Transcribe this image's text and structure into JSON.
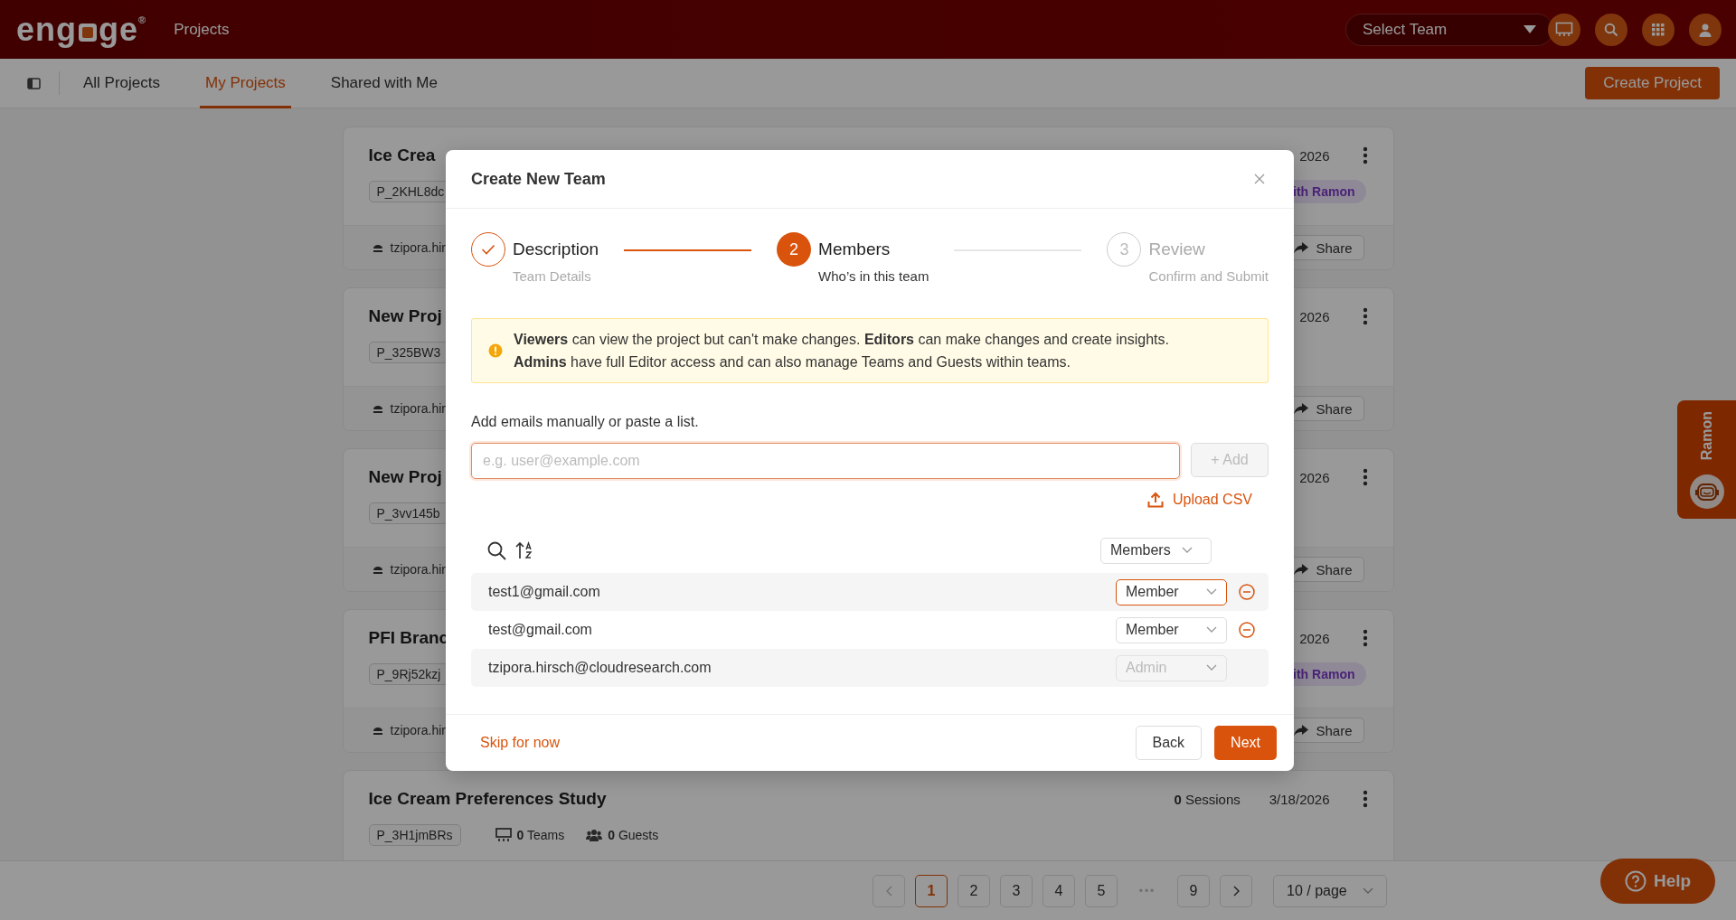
{
  "header": {
    "logo": {
      "before": "eng",
      "after": "ge",
      "mark": "®"
    },
    "section": "Projects",
    "team_select": {
      "placeholder": "Select Team"
    }
  },
  "subnav": {
    "tabs": [
      {
        "label": "All Projects",
        "selected": false
      },
      {
        "label": "My Projects",
        "selected": true
      },
      {
        "label": "Shared with Me",
        "selected": false
      }
    ],
    "create_button": "Create Project"
  },
  "projects": [
    {
      "title": "Ice Crea",
      "id": "P_2KHL8dc",
      "date": "2026",
      "badge": "ith Ramon",
      "owner": "tzipora.hir",
      "share": "Share"
    },
    {
      "title": "New Proj",
      "id": "P_325BW3",
      "date": "2026",
      "owner": "tzipora.hir",
      "share": "Share"
    },
    {
      "title": "New Proj",
      "id": "P_3vv145b",
      "date": "2026",
      "owner": "tzipora.hir",
      "share": "Share"
    },
    {
      "title": "PFI Branc",
      "id": "P_9Rj52kzj",
      "date": "2026",
      "badge": "ith Ramon",
      "owner": "tzipora.hir",
      "share": "Share"
    },
    {
      "title": "Ice Cream Preferences Study",
      "id": "P_3H1jmBRs",
      "date": "3/18/2026",
      "sessions": {
        "count": "0",
        "label": "Sessions"
      },
      "teams": {
        "count": "0",
        "label": "Teams"
      },
      "guests": {
        "count": "0",
        "label": "Guests"
      }
    }
  ],
  "pagination": {
    "pages": [
      {
        "label": "1",
        "selected": true
      },
      {
        "label": "2",
        "selected": false
      },
      {
        "label": "3",
        "selected": false
      },
      {
        "label": "4",
        "selected": false
      },
      {
        "label": "5",
        "selected": false
      },
      {
        "label": "9",
        "selected": false
      }
    ],
    "ellipsis": "•••",
    "page_size": "10 / page"
  },
  "ramon_tab": {
    "label": "Ramon"
  },
  "help_button": "Help",
  "modal": {
    "title": "Create New Team",
    "steps": [
      {
        "title": "Description",
        "subtitle": "Team Details",
        "completed": true,
        "current": false
      },
      {
        "number": "2",
        "title": "Members",
        "subtitle": "Who’s in this team",
        "completed": false,
        "current": true
      },
      {
        "number": "3",
        "title": "Review",
        "subtitle": "Confirm and Submit",
        "completed": false,
        "current": false
      }
    ],
    "alert": [
      "**Viewers** can view the project but can't make changes. **Editors** can make changes and create insights.",
      "**Admins** have full Editor access and can also manage Teams and Guests within teams."
    ],
    "email_label": "Add emails manually or paste a list.",
    "email_input": {
      "placeholder": "e.g. user@example.com"
    },
    "add_button": {
      "label": "+ Add",
      "disabled": true
    },
    "upload_link": "Upload CSV",
    "filter_select": "Members",
    "members": [
      {
        "email": "test1@gmail.com",
        "role": "Member",
        "highlighted": true,
        "disabled": false,
        "removable": true
      },
      {
        "email": "test@gmail.com",
        "role": "Member",
        "highlighted": false,
        "disabled": false,
        "removable": true
      },
      {
        "email": "tzipora.hirsch@cloudresearch.com",
        "role": "Admin",
        "highlighted": false,
        "disabled": true,
        "removable": false
      }
    ],
    "skip_link": "Skip for now",
    "back_button": "Back",
    "next_button": "Next"
  }
}
